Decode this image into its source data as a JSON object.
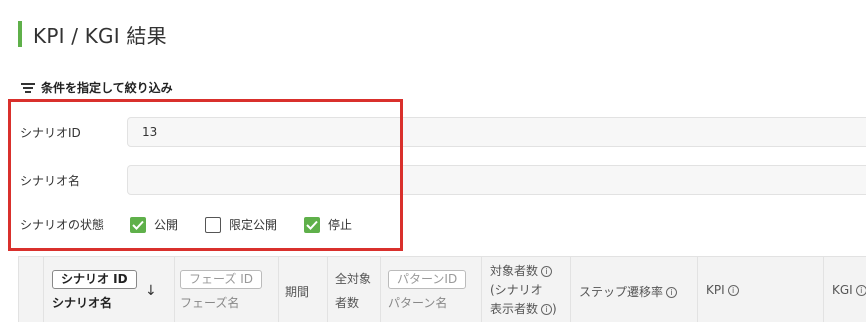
{
  "page": {
    "title": "KPI / KGI 結果"
  },
  "filter": {
    "heading": "条件を指定して絞り込み",
    "scenario_id": {
      "label": "シナリオID",
      "value": "13"
    },
    "scenario_name": {
      "label": "シナリオ名",
      "value": ""
    },
    "status": {
      "label": "シナリオの状態",
      "options": [
        {
          "label": "公開",
          "checked": true
        },
        {
          "label": "限定公開",
          "checked": false
        },
        {
          "label": "停止",
          "checked": true
        }
      ]
    }
  },
  "table": {
    "columns": {
      "scenario_id": "シナリオ ID",
      "scenario_name": "シナリオ名",
      "sort_arrow": "↓",
      "phase_id": "フェーズ ID",
      "phase_name": "フェーズ名",
      "period": "期間",
      "total_targets_1": "全対象",
      "total_targets_2": "者数",
      "pattern_id": "パターンID",
      "pattern_name": "パターン名",
      "targets_1": "対象者数",
      "targets_2": "(シナリオ",
      "targets_3": "表示者数",
      "step_rate": "ステップ遷移率",
      "kpi": "KPI",
      "kgi": "KGI"
    }
  },
  "colors": {
    "accent": "#5fb04a",
    "highlight": "#d9302c"
  }
}
